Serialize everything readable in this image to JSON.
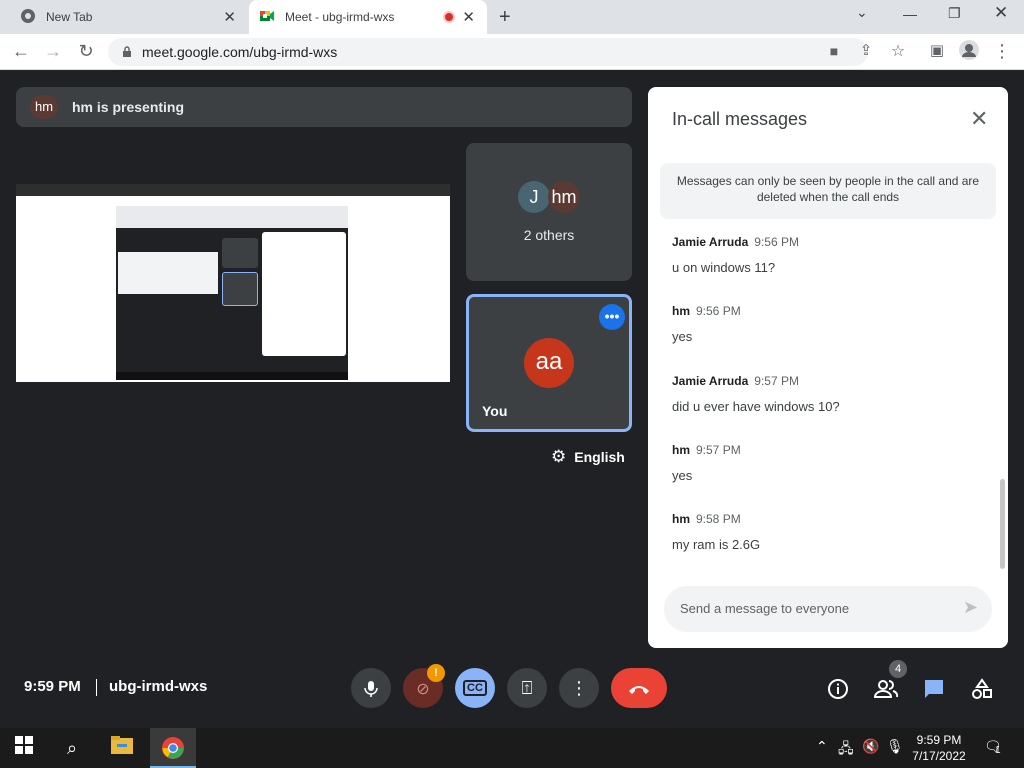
{
  "browser": {
    "tabs": [
      {
        "title": "New Tab",
        "active": false,
        "icon": "chrome-icon"
      },
      {
        "title": "Meet - ubg-irmd-wxs",
        "active": true,
        "icon": "meet-icon",
        "recording": true
      }
    ],
    "url": "meet.google.com/ubg-irmd-wxs"
  },
  "meet": {
    "banner": {
      "avatar": "hm",
      "text": "hm is presenting"
    },
    "tiles": {
      "others": {
        "avatars": [
          "J",
          "hm"
        ],
        "label": "2 others"
      },
      "you": {
        "avatar": "aa",
        "label": "You"
      }
    },
    "language": "English",
    "clock": "9:59 PM",
    "meeting_code": "ubg-irmd-wxs",
    "people_count": "4",
    "camera_warning": "!",
    "captions_label": "CC"
  },
  "chat": {
    "title": "In-call messages",
    "notice": "Messages can only be seen by people in the call and are deleted when the call ends",
    "messages": [
      {
        "sender": "Jamie Arruda",
        "time": "9:56 PM",
        "text": "u on windows 11?"
      },
      {
        "sender": "hm",
        "time": "9:56 PM",
        "text": "yes"
      },
      {
        "sender": "Jamie Arruda",
        "time": "9:57 PM",
        "text": "did u ever have windows 10?"
      },
      {
        "sender": "hm",
        "time": "9:57 PM",
        "text": "yes"
      },
      {
        "sender": "hm",
        "time": "9:58 PM",
        "text": "my ram is 2.6G"
      }
    ],
    "input_placeholder": "Send a message to everyone"
  },
  "taskbar": {
    "time": "9:59 PM",
    "date": "7/17/2022",
    "notification_count": "1"
  },
  "colors": {
    "meet_bg": "#202124",
    "tile_bg": "#3c4043",
    "accent_blue": "#8ab4f8",
    "end_call_red": "#ea4335",
    "avatar_aa": "#c5361b"
  }
}
